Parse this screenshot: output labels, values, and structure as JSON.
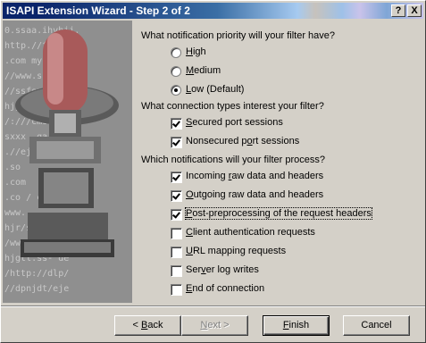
{
  "window": {
    "title": "ISAPI Extension Wizard - Step 2 of 2",
    "help_label": "?",
    "close_label": "X"
  },
  "art_text": [
    "0.ssaa.ihvhjj.",
    "http.//fp.host",
    ".com        my",
    "//www.ssbhjjk",
    "//ssfsu/erik",
    "hjjk      nbc",
    "/:///cmsr  do",
    "sxxx      .ga",
    "  .//ej ",
    "          .so",
    "  .com",
    "  .co   /   com",
    "         www.",
    "hjr/s.l.ocm",
    "/www/  ,wwwwwp",
    "hjgtl.ss-  de",
    "/http://dlp/",
    "//dpnjdt/eje "
  ],
  "priority": {
    "question": "What notification priority will your filter have?",
    "options": [
      {
        "label": "High",
        "mnemonic": "H",
        "selected": false
      },
      {
        "label": "Medium",
        "mnemonic": "M",
        "selected": false
      },
      {
        "label": "Low (Default)",
        "mnemonic": "L",
        "selected": true
      }
    ]
  },
  "connection": {
    "question": "What connection types interest your filter?",
    "options": [
      {
        "label": "Secured port sessions",
        "checked": true
      },
      {
        "label": "Nonsecured port sessions",
        "checked": true
      }
    ]
  },
  "notifications": {
    "question": "Which notifications will your filter process?",
    "options": [
      {
        "label": "Incoming raw data and headers",
        "checked": true
      },
      {
        "label": "Outgoing raw data and headers",
        "checked": true
      },
      {
        "label": "Post-preprocessing of the request headers",
        "checked": true,
        "focused": true
      },
      {
        "label": "Client authentication requests",
        "checked": false
      },
      {
        "label": "URL mapping requests",
        "checked": false
      },
      {
        "label": "Server log writes",
        "checked": false
      },
      {
        "label": "End of connection",
        "checked": false
      }
    ]
  },
  "buttons": {
    "back": "< Back",
    "next": "Next >",
    "finish": "Finish",
    "cancel": "Cancel"
  }
}
